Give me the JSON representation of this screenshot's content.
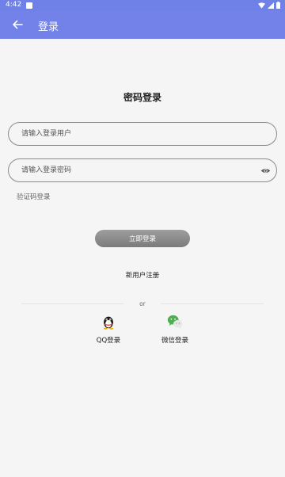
{
  "status": {
    "time": "4:42"
  },
  "app_bar": {
    "title": "登录"
  },
  "page_title": "密码登录",
  "username": {
    "placeholder": "请输入登录用户"
  },
  "password": {
    "placeholder": "请输入登录密码"
  },
  "sms_login_link": "验证码登录",
  "login_button": "立即登录",
  "register_link": "新用户注册",
  "or_text": "or",
  "social": [
    {
      "label": "QQ登录",
      "icon": "qq-icon"
    },
    {
      "label": "微信登录",
      "icon": "wechat-icon"
    }
  ],
  "colors": {
    "app_bar": "#7282e8",
    "button": "#8c8c8c",
    "background": "#f5f5f5"
  }
}
